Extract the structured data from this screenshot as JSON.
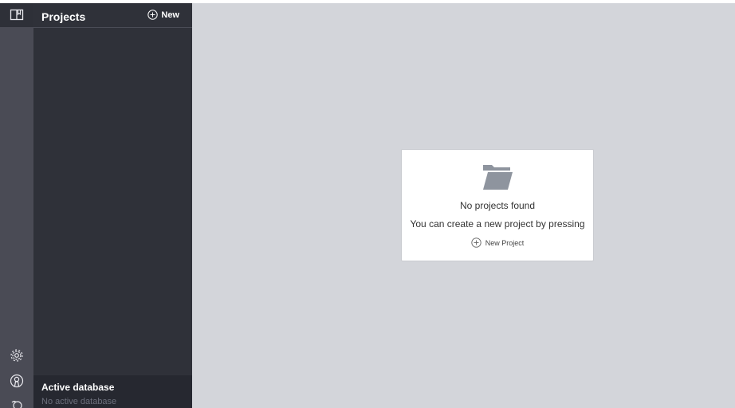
{
  "sidebar": {
    "title": "Projects",
    "new_label": "New",
    "active_database": {
      "title": "Active database",
      "value": "No active database"
    }
  },
  "rail": {
    "icons": [
      "book-icon",
      "gear-icon",
      "user-icon",
      "link-icon"
    ]
  },
  "main": {
    "empty_state": {
      "icon": "folder-open-icon",
      "title": "No projects found",
      "description": "You can create a new project by pressing",
      "action_label": "New Project"
    }
  },
  "colors": {
    "rail": "#4a4b55",
    "sidebar": "#2f3139",
    "main_background": "#d3d5da",
    "folder": "#8e949e"
  }
}
